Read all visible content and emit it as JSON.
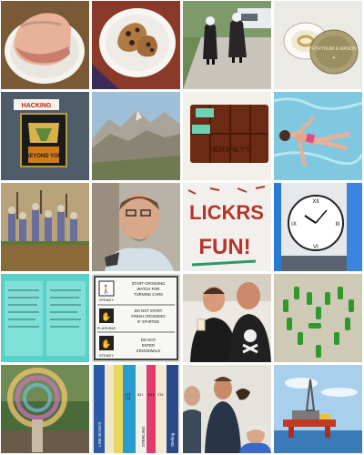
{
  "grid": {
    "columns": 4,
    "rows": 5
  },
  "tiles": [
    {
      "subject": "ham on a plate"
    },
    {
      "subject": "cookies on a plate"
    },
    {
      "subject": "nuns walking on a street"
    },
    {
      "subject": "ring in a tin box",
      "text": "FORTNUM & MASON"
    },
    {
      "subject": "embroidered patch",
      "text_top": "HACKING",
      "text_bottom": "BEYOND YOU"
    },
    {
      "subject": "mountain landscape"
    },
    {
      "subject": "chocolate bar",
      "text": "HERSHEY'S"
    },
    {
      "subject": "girl swimming in pool"
    },
    {
      "subject": "miniature figurines"
    },
    {
      "subject": "bearded man portrait"
    },
    {
      "subject": "letters spelled on wall",
      "text": "LICKRS FUN!"
    },
    {
      "subject": "clock tower face"
    },
    {
      "subject": "notebook page of writing"
    },
    {
      "subject": "crosswalk sign",
      "rows": [
        {
          "icon": "STEADY",
          "text": "START CROSSING WATCH FOR TURNING CARS"
        },
        {
          "icon": "FLASHING",
          "text": "DO NOT START FINISH CROSSING IF STARTED"
        },
        {
          "icon": "STEADY",
          "text": "DO NOT ENTER CROSSWALK"
        }
      ]
    },
    {
      "subject": "two men with drinks",
      "text": "skull and crossbones shirt"
    },
    {
      "subject": "green bottles in heart shape"
    },
    {
      "subject": "spinning light blur"
    },
    {
      "subject": "books on shelf",
      "spines": [
        "172 ITA",
        "851",
        "851 ITA B",
        "LINE BOOKS",
        "STERLING",
        "Sterling Books"
      ]
    },
    {
      "subject": "three men listening"
    },
    {
      "subject": "offshore oil rig"
    }
  ]
}
